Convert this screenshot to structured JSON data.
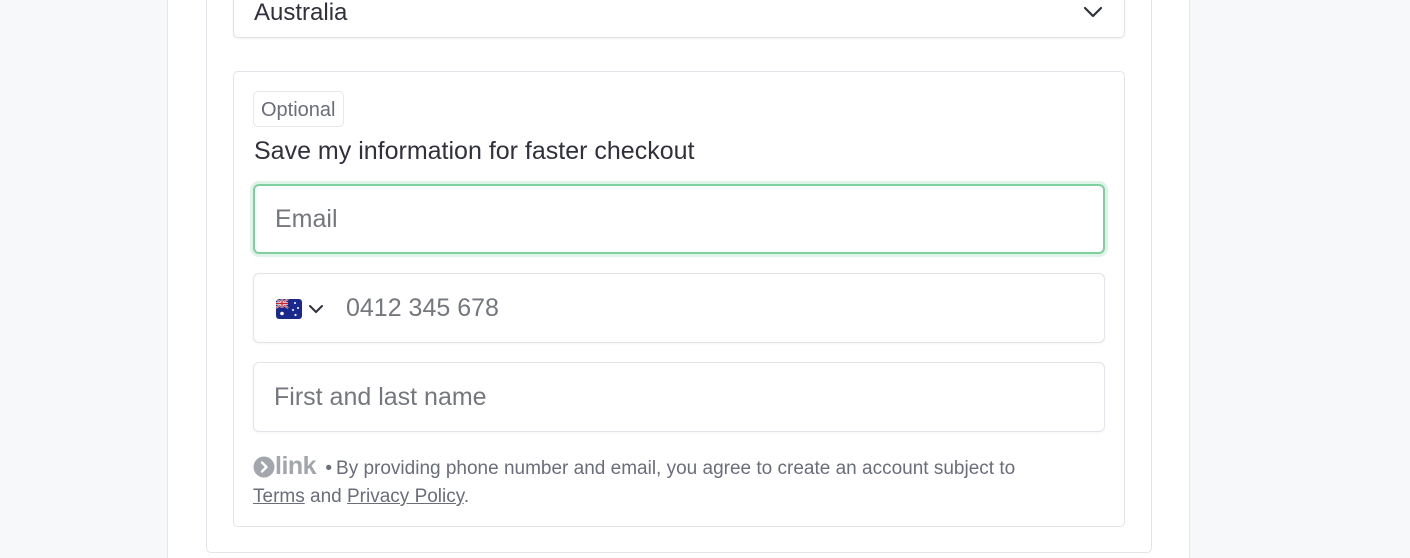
{
  "country_select": {
    "value": "Australia",
    "icon": "chevron-down-icon"
  },
  "link_section": {
    "optional_label": "Optional",
    "heading": "Save my information for faster checkout",
    "email": {
      "placeholder": "Email",
      "value": ""
    },
    "phone": {
      "placeholder": "0412 345 678",
      "value": "",
      "country_flag": "australia-flag-icon"
    },
    "name": {
      "placeholder": "First and last name",
      "value": ""
    },
    "legal": {
      "brand": "link",
      "separator": "•",
      "text": "By providing phone number and email, you agree to create an account subject to",
      "terms_label": "Terms",
      "and_label": "and",
      "privacy_label": "Privacy Policy",
      "end": "."
    }
  },
  "colors": {
    "focus_border": "#7fcf9f",
    "text": "#30313d",
    "muted": "#6a6d7a"
  }
}
